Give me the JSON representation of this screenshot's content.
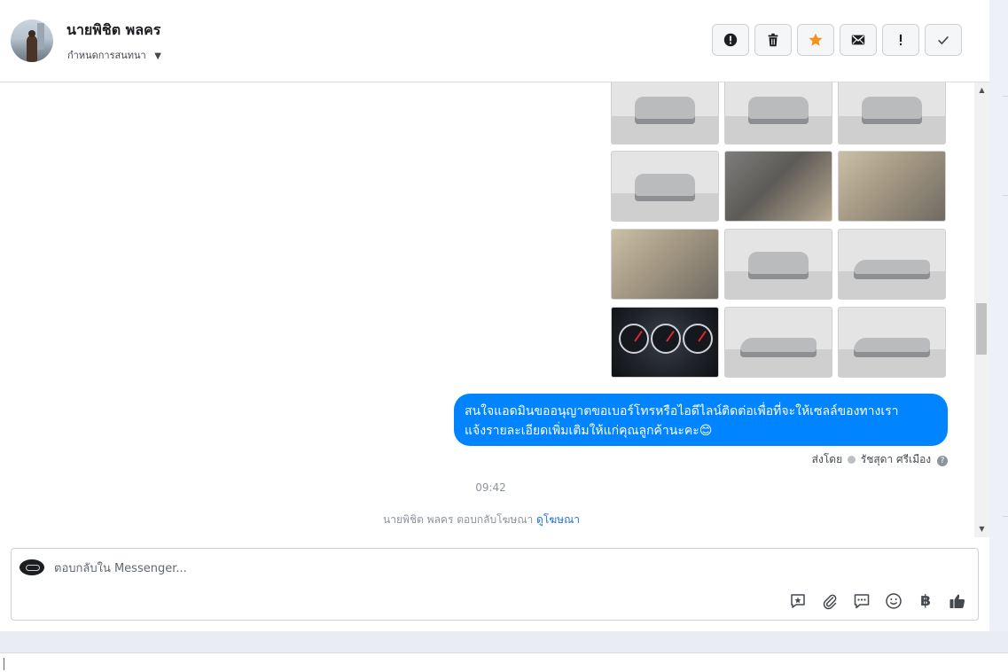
{
  "header": {
    "contact_name": "นายพิชิต พลคร",
    "assign_label": "กำหนดการสนทนา",
    "actions": [
      {
        "name": "mark-spam-button",
        "icon": "exclamation-circle-icon"
      },
      {
        "name": "delete-button",
        "icon": "trash-icon"
      },
      {
        "name": "star-button",
        "icon": "star-icon"
      },
      {
        "name": "mark-unread-button",
        "icon": "envelope-icon"
      },
      {
        "name": "follow-up-button",
        "icon": "exclamation-icon"
      },
      {
        "name": "mark-done-button",
        "icon": "check-icon"
      }
    ]
  },
  "conversation": {
    "photo_attachments": [
      {
        "kind": "car-front"
      },
      {
        "kind": "car-front"
      },
      {
        "kind": "car-front"
      },
      {
        "kind": "car-rear"
      },
      {
        "kind": "interior-console"
      },
      {
        "kind": "interior-rear-seat"
      },
      {
        "kind": "interior-front-seat"
      },
      {
        "kind": "car-rear"
      },
      {
        "kind": "car-side"
      },
      {
        "kind": "dashboard"
      },
      {
        "kind": "car-side"
      },
      {
        "kind": "car-rear-quarter"
      }
    ],
    "message_line1": "สนใจแอดมินขออนุญาตขอเบอร์โทรหรือไอดีไลน์ติดต่อเพื่อที่จะให้เซลล์ของทางเรา",
    "message_line2": "แจ้งรายละเอียดเพิ่มเติมให้แก่คุณลูกค้านะคะ😊",
    "sent_by_prefix": "ส่งโดย",
    "sent_by_name": "รัชสุดา ศรีเมือง",
    "time": "09:42",
    "ad_reply_text": "นายพิชิต พลคร ตอบกลับโฆษณา",
    "ad_link": "ดูโฆษณา"
  },
  "composer": {
    "placeholder": "ตอบกลับใน Messenger...",
    "currency_symbol": "฿",
    "tools": [
      "saved-reply-icon",
      "paperclip-icon",
      "chat-icon",
      "emoji-icon",
      "baht-icon",
      "thumbs-up-icon"
    ]
  },
  "colors": {
    "bubble": "#0084ff",
    "star": "#f5911e",
    "link": "#216fdb"
  }
}
